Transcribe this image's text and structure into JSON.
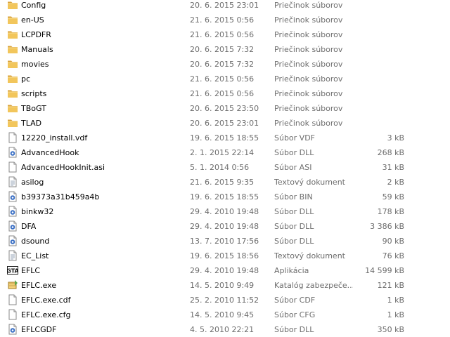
{
  "files": [
    {
      "name": "Config",
      "date": "20. 6. 2015 23:01",
      "type": "Priečinok súborov",
      "size": "",
      "icon": "folder-icon"
    },
    {
      "name": "en-US",
      "date": "21. 6. 2015 0:56",
      "type": "Priečinok súborov",
      "size": "",
      "icon": "folder-icon"
    },
    {
      "name": "LCPDFR",
      "date": "21. 6. 2015 0:56",
      "type": "Priečinok súborov",
      "size": "",
      "icon": "folder-icon"
    },
    {
      "name": "Manuals",
      "date": "20. 6. 2015 7:32",
      "type": "Priečinok súborov",
      "size": "",
      "icon": "folder-icon"
    },
    {
      "name": "movies",
      "date": "20. 6. 2015 7:32",
      "type": "Priečinok súborov",
      "size": "",
      "icon": "folder-icon"
    },
    {
      "name": "pc",
      "date": "21. 6. 2015 0:56",
      "type": "Priečinok súborov",
      "size": "",
      "icon": "folder-icon"
    },
    {
      "name": "scripts",
      "date": "21. 6. 2015 0:56",
      "type": "Priečinok súborov",
      "size": "",
      "icon": "folder-icon"
    },
    {
      "name": "TBoGT",
      "date": "20. 6. 2015 23:50",
      "type": "Priečinok súborov",
      "size": "",
      "icon": "folder-icon"
    },
    {
      "name": "TLAD",
      "date": "20. 6. 2015 23:01",
      "type": "Priečinok súborov",
      "size": "",
      "icon": "folder-icon"
    },
    {
      "name": "12220_install.vdf",
      "date": "19. 6. 2015 18:55",
      "type": "Súbor VDF",
      "size": "3 kB",
      "icon": "file-icon"
    },
    {
      "name": "AdvancedHook",
      "date": "2. 1. 2015 22:14",
      "type": "Súbor DLL",
      "size": "268 kB",
      "icon": "dll-icon"
    },
    {
      "name": "AdvancedHookInit.asi",
      "date": "5. 1. 2014 0:56",
      "type": "Súbor ASI",
      "size": "31 kB",
      "icon": "file-icon"
    },
    {
      "name": "asilog",
      "date": "21. 6. 2015 9:35",
      "type": "Textový dokument",
      "size": "2 kB",
      "icon": "text-document-icon"
    },
    {
      "name": "b39373a31b459a4b",
      "date": "19. 6. 2015 18:55",
      "type": "Súbor BIN",
      "size": "59 kB",
      "icon": "dll-icon"
    },
    {
      "name": "binkw32",
      "date": "29. 4. 2010 19:48",
      "type": "Súbor DLL",
      "size": "178 kB",
      "icon": "dll-icon"
    },
    {
      "name": "DFA",
      "date": "29. 4. 2010 19:48",
      "type": "Súbor DLL",
      "size": "3 386 kB",
      "icon": "dll-icon"
    },
    {
      "name": "dsound",
      "date": "13. 7. 2010 17:56",
      "type": "Súbor DLL",
      "size": "90 kB",
      "icon": "dll-icon"
    },
    {
      "name": "EC_List",
      "date": "19. 6. 2015 18:56",
      "type": "Textový dokument",
      "size": "76 kB",
      "icon": "text-document-icon"
    },
    {
      "name": "EFLC",
      "date": "29. 4. 2010 19:48",
      "type": "Aplikácia",
      "size": "14 599 kB",
      "icon": "gta-app-icon"
    },
    {
      "name": "EFLC.exe",
      "date": "14. 5. 2010 9:49",
      "type": "Katalóg zabezpeče...",
      "size": "121 kB",
      "icon": "security-catalog-icon"
    },
    {
      "name": "EFLC.exe.cdf",
      "date": "25. 2. 2010 11:52",
      "type": "Súbor CDF",
      "size": "1 kB",
      "icon": "file-icon"
    },
    {
      "name": "EFLC.exe.cfg",
      "date": "14. 5. 2010 9:45",
      "type": "Súbor CFG",
      "size": "1 kB",
      "icon": "file-icon"
    },
    {
      "name": "EFLCGDF",
      "date": "4. 5. 2010 22:21",
      "type": "Súbor DLL",
      "size": "350 kB",
      "icon": "dll-icon"
    }
  ],
  "colors": {
    "folder": "#e8b84a",
    "secondary_text": "#6d6d6d",
    "dll_accent": "#3a6fc4"
  }
}
